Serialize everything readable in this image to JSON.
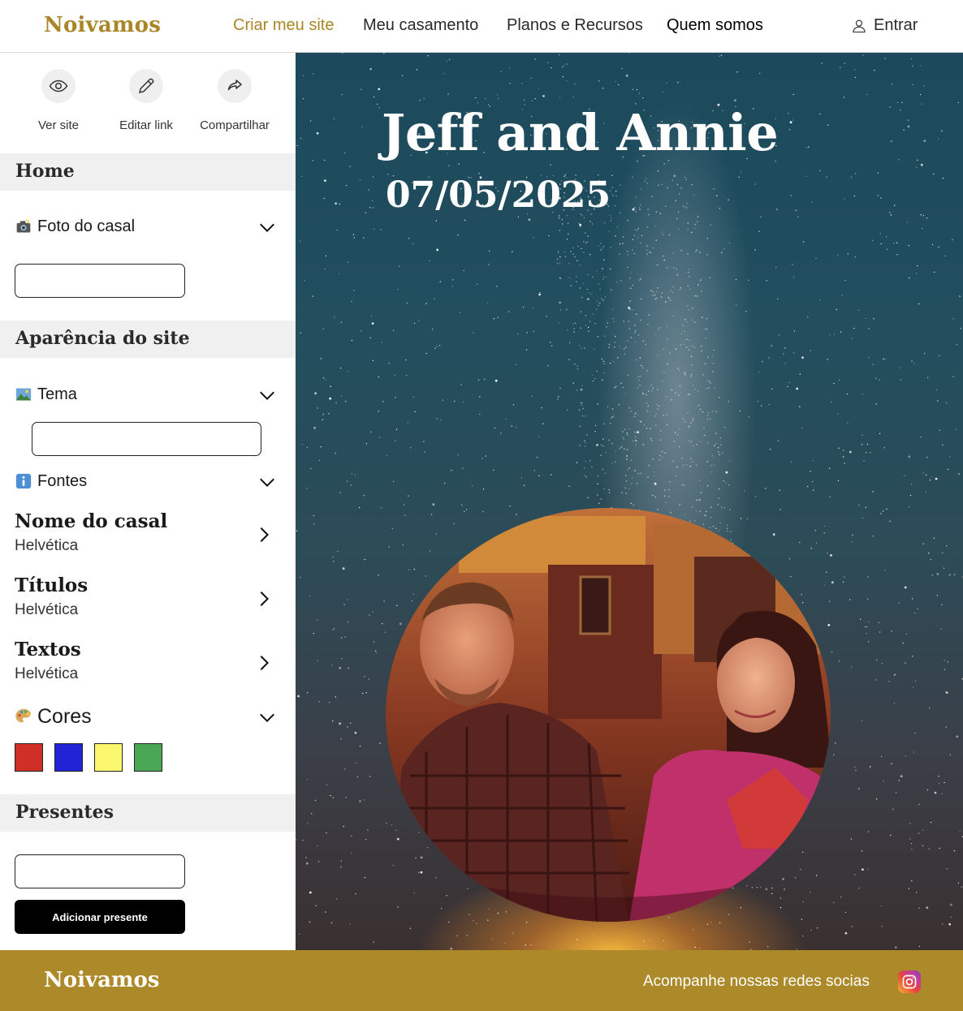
{
  "header": {
    "logo": "Noivamos",
    "nav": [
      {
        "label": "Criar meu site",
        "active": true
      },
      {
        "label": "Meu casamento"
      },
      {
        "label": "Planos e Recursos"
      },
      {
        "label": "Quem somos"
      }
    ],
    "login_label": "Entrar",
    "login_icon": "user-icon"
  },
  "toolbar": {
    "view": {
      "label": "Ver site",
      "icon": "eye-icon"
    },
    "edit": {
      "label": "Editar link",
      "icon": "pencil-icon"
    },
    "share": {
      "label": "Compartilhar",
      "icon": "share-icon"
    }
  },
  "sections": {
    "home": {
      "title": "Home",
      "couple_photo": {
        "label": "Foto do casal",
        "icon": "camera-icon",
        "value": ""
      }
    },
    "appearance": {
      "title": "Aparência do site",
      "theme": {
        "label": "Tema",
        "icon": "landscape-icon",
        "value": ""
      },
      "fonts": {
        "label": "Fontes",
        "icon": "info-icon",
        "items": [
          {
            "title": "Nome do casal",
            "value": "Helvética"
          },
          {
            "title": "Títulos",
            "value": "Helvética"
          },
          {
            "title": "Textos",
            "value": "Helvética"
          }
        ]
      },
      "colors": {
        "label": "Cores",
        "icon": "palette-icon",
        "swatches": [
          "#d02f27",
          "#2222d6",
          "#fbf76e",
          "#4aa755"
        ]
      }
    },
    "gifts": {
      "title": "Presentes",
      "input_value": "",
      "add_button": "Adicionar presente"
    }
  },
  "preview": {
    "couple_name": "Jeff and Annie",
    "date": "07/05/2025"
  },
  "footer": {
    "logo": "Noivamos",
    "social_text": "Acompanhe nossas redes socias",
    "social_icon": "instagram-icon"
  },
  "colors": {
    "brand_gold": "#a98627",
    "footer_gold": "#ac8a2a"
  }
}
